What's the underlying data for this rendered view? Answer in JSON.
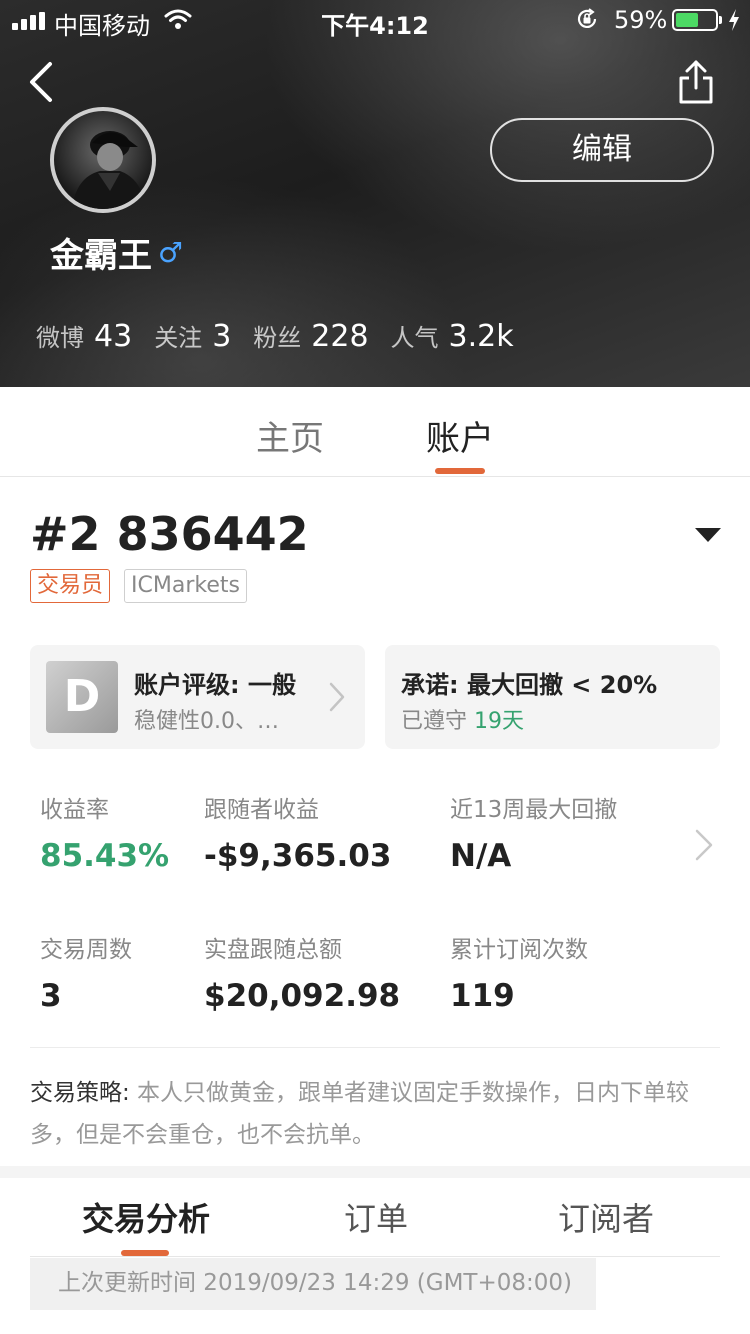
{
  "status_bar": {
    "carrier": "中国移动",
    "time": "下午4:12",
    "battery_percent": "59%",
    "battery_level": 0.59,
    "icons": [
      "signal-icon",
      "wifi-icon",
      "rotation-lock-icon",
      "battery-icon",
      "charging-bolt-icon"
    ]
  },
  "header": {
    "edit_label": "编辑",
    "username": "金霸王",
    "gender_symbol": "♂",
    "stats": [
      {
        "label": "微博",
        "value": "43"
      },
      {
        "label": "关注",
        "value": "3"
      },
      {
        "label": "粉丝",
        "value": "228"
      },
      {
        "label": "人气",
        "value": "3.2k"
      }
    ]
  },
  "main_tabs": [
    {
      "label": "主页",
      "active": false
    },
    {
      "label": "账户",
      "active": true
    }
  ],
  "account": {
    "number": "#2 836442",
    "tags": [
      "交易员",
      "ICMarkets"
    ],
    "rating": {
      "grade": "D",
      "title": "账户评级: 一般",
      "subtitle": "稳健性0.0、…"
    },
    "promise": {
      "title": "承诺: 最大回撤 < 20%",
      "prefix": "已遵守",
      "days": "19天"
    },
    "metrics": [
      {
        "label": "收益率",
        "value": "85.43%"
      },
      {
        "label": "跟随者收益",
        "value": "-$9,365.03"
      },
      {
        "label": "近13周最大回撤",
        "value": "N/A"
      },
      {
        "label": "交易周数",
        "value": "3"
      },
      {
        "label": "实盘跟随总额",
        "value": "$20,092.98"
      },
      {
        "label": "累计订阅次数",
        "value": "119"
      }
    ],
    "strategy_label": "交易策略:",
    "strategy_text": " 本人只做黄金，跟单者建议固定手数操作，日内下单较多，但是不会重仓，也不会抗单。"
  },
  "sub_tabs": [
    {
      "label": "交易分析",
      "active": true
    },
    {
      "label": "订单",
      "active": false
    },
    {
      "label": "订阅者",
      "active": false
    }
  ],
  "last_update": "上次更新时间 2019/09/23 14:29 (GMT+08:00)",
  "colors": {
    "accent": "#e2683a",
    "positive": "#35a26f",
    "gender": "#4aa3ff"
  }
}
